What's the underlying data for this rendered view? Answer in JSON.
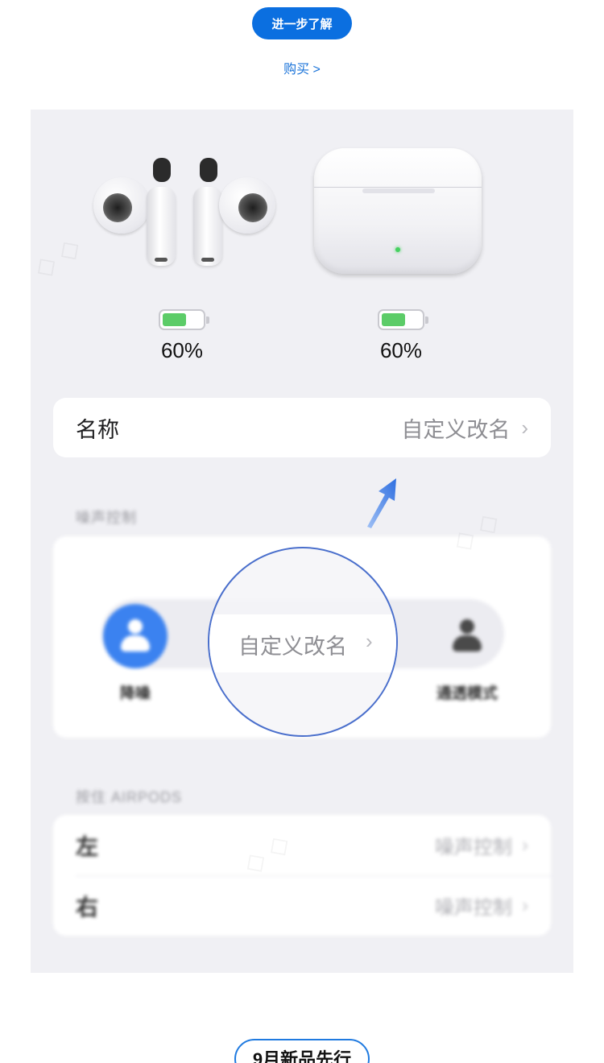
{
  "cta": {
    "learn_more": "进一步了解",
    "buy": "购买 >"
  },
  "device": {
    "earbuds_battery": "60%",
    "case_battery": "60%",
    "earbuds_battery_level": 0.6,
    "case_battery_level": 0.6
  },
  "name_row": {
    "label": "名称",
    "value": "自定义改名",
    "chevron": "›"
  },
  "noise_control": {
    "section_title": "噪声控制",
    "modes": [
      {
        "label": "降噪",
        "active": true
      },
      {
        "label": "通透模式",
        "active": false
      }
    ]
  },
  "magnifier": {
    "text": "自定义改名",
    "chevron": "›"
  },
  "press_hold": {
    "section_title": "按住 AIRPODS",
    "rows": [
      {
        "label": "左",
        "value": "噪声控制",
        "chevron": "›"
      },
      {
        "label": "右",
        "value": "噪声控制",
        "chevron": "›"
      }
    ]
  },
  "footer": {
    "pill_label": "9月新品先行"
  },
  "colors": {
    "accent": "#0b6fe0",
    "battery_fill": "#5ccc68",
    "active_mode": "#3b82f0",
    "arrow": "#2f6fe0",
    "magnifier_border": "#4a6fcc"
  },
  "icons": [
    "arrow-pointer-icon",
    "person-icon",
    "chevron-right-icon",
    "battery-icon",
    "led-indicator"
  ]
}
